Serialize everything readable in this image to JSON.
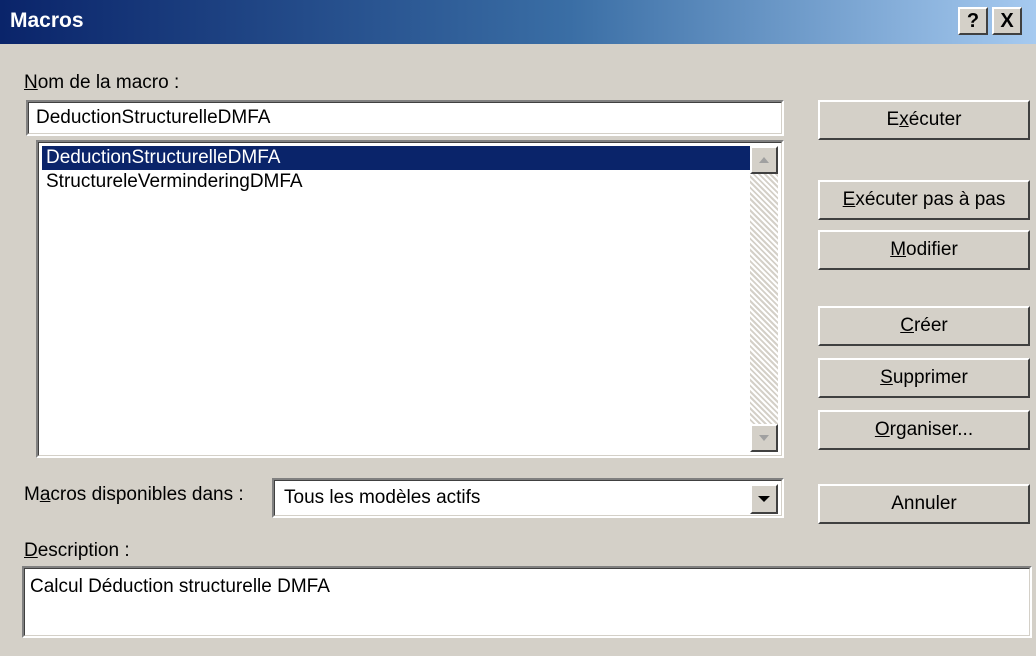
{
  "window": {
    "title": "Macros",
    "help_label": "?",
    "close_label": "X"
  },
  "macro_name": {
    "label_prefix": "N",
    "label_rest": "om de la macro :",
    "value": "DeductionStructurelleDMFA"
  },
  "macro_list": {
    "items": [
      {
        "label": "DeductionStructurelleDMFA",
        "selected": true
      },
      {
        "label": "StructureleVerminderingDMFA",
        "selected": false
      }
    ]
  },
  "buttons": {
    "run": {
      "pre": "E",
      "key": "x",
      "post": "écuter"
    },
    "step": {
      "pre": "",
      "key": "E",
      "post": "xécuter pas à pas"
    },
    "edit": {
      "pre": "",
      "key": "M",
      "post": "odifier"
    },
    "create": {
      "pre": "",
      "key": "C",
      "post": "réer"
    },
    "delete": {
      "pre": "",
      "key": "S",
      "post": "upprimer"
    },
    "organize": {
      "pre": "",
      "key": "O",
      "post": "rganiser..."
    },
    "cancel": {
      "label": "Annuler"
    }
  },
  "macros_in": {
    "label_pre": "M",
    "label_key": "a",
    "label_post": "cros disponibles dans :",
    "selected": "Tous les modèles actifs"
  },
  "description": {
    "label_key": "D",
    "label_post": "escription :",
    "text": "Calcul Déduction structurelle DMFA"
  },
  "colors": {
    "titlebar_start": "#0a246a",
    "titlebar_end": "#a6caf0",
    "dialog_bg": "#d4d0c8",
    "selection": "#0a246a"
  }
}
